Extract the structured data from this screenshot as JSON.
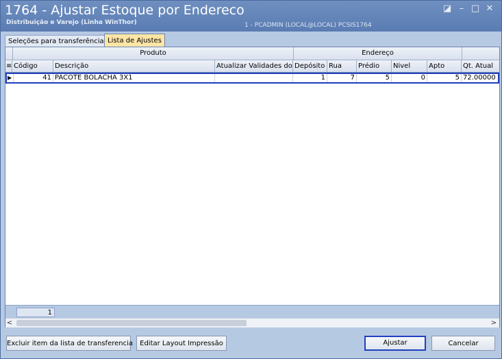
{
  "window": {
    "title": "1764 - Ajustar Estoque por Endereco",
    "subtitle": "Distribuição e Varejo (Linha WinThor)",
    "user_info": "1 - PCADMIN (LOCAL@LOCAL)   PCSIS1764",
    "controls": {
      "restore_icon": "◪",
      "minimize_icon": "–",
      "maximize_icon": "□",
      "close_icon": "✕"
    }
  },
  "tabs": [
    {
      "label": "Seleções para transferências",
      "active": false
    },
    {
      "label": "Lista de Ajustes",
      "active": true
    }
  ],
  "grid": {
    "bands": {
      "produto": "Produto",
      "endereco": "Endereço"
    },
    "columns": {
      "codigo": "Código",
      "descricao": "Descrição",
      "atualizar": "Atualizar Validades do Lo",
      "deposito": "Depósito",
      "rua": "Rua",
      "predio": "Prédio",
      "nivel": "Nivel",
      "apto": "Apto",
      "qt_atual": "Qt. Atual"
    },
    "rows": [
      {
        "codigo": "41",
        "descricao": "PACOTE BOLACHA 3X1",
        "atualizar": "",
        "deposito": "1",
        "rua": "7",
        "predio": "5",
        "nivel": "0",
        "apto": "5",
        "qt_atual": "72.00000"
      }
    ],
    "footer_count": "1",
    "row_indicator": "▶",
    "column_chooser_icon": "≡"
  },
  "scrollbar": {
    "left_arrow": "<",
    "right_arrow": ">"
  },
  "buttons": {
    "excluir": "Excluir item da lista de transferencia",
    "editar_layout": "Editar Layout Impressão",
    "ajustar": "Ajustar",
    "cancelar": "Cancelar"
  }
}
